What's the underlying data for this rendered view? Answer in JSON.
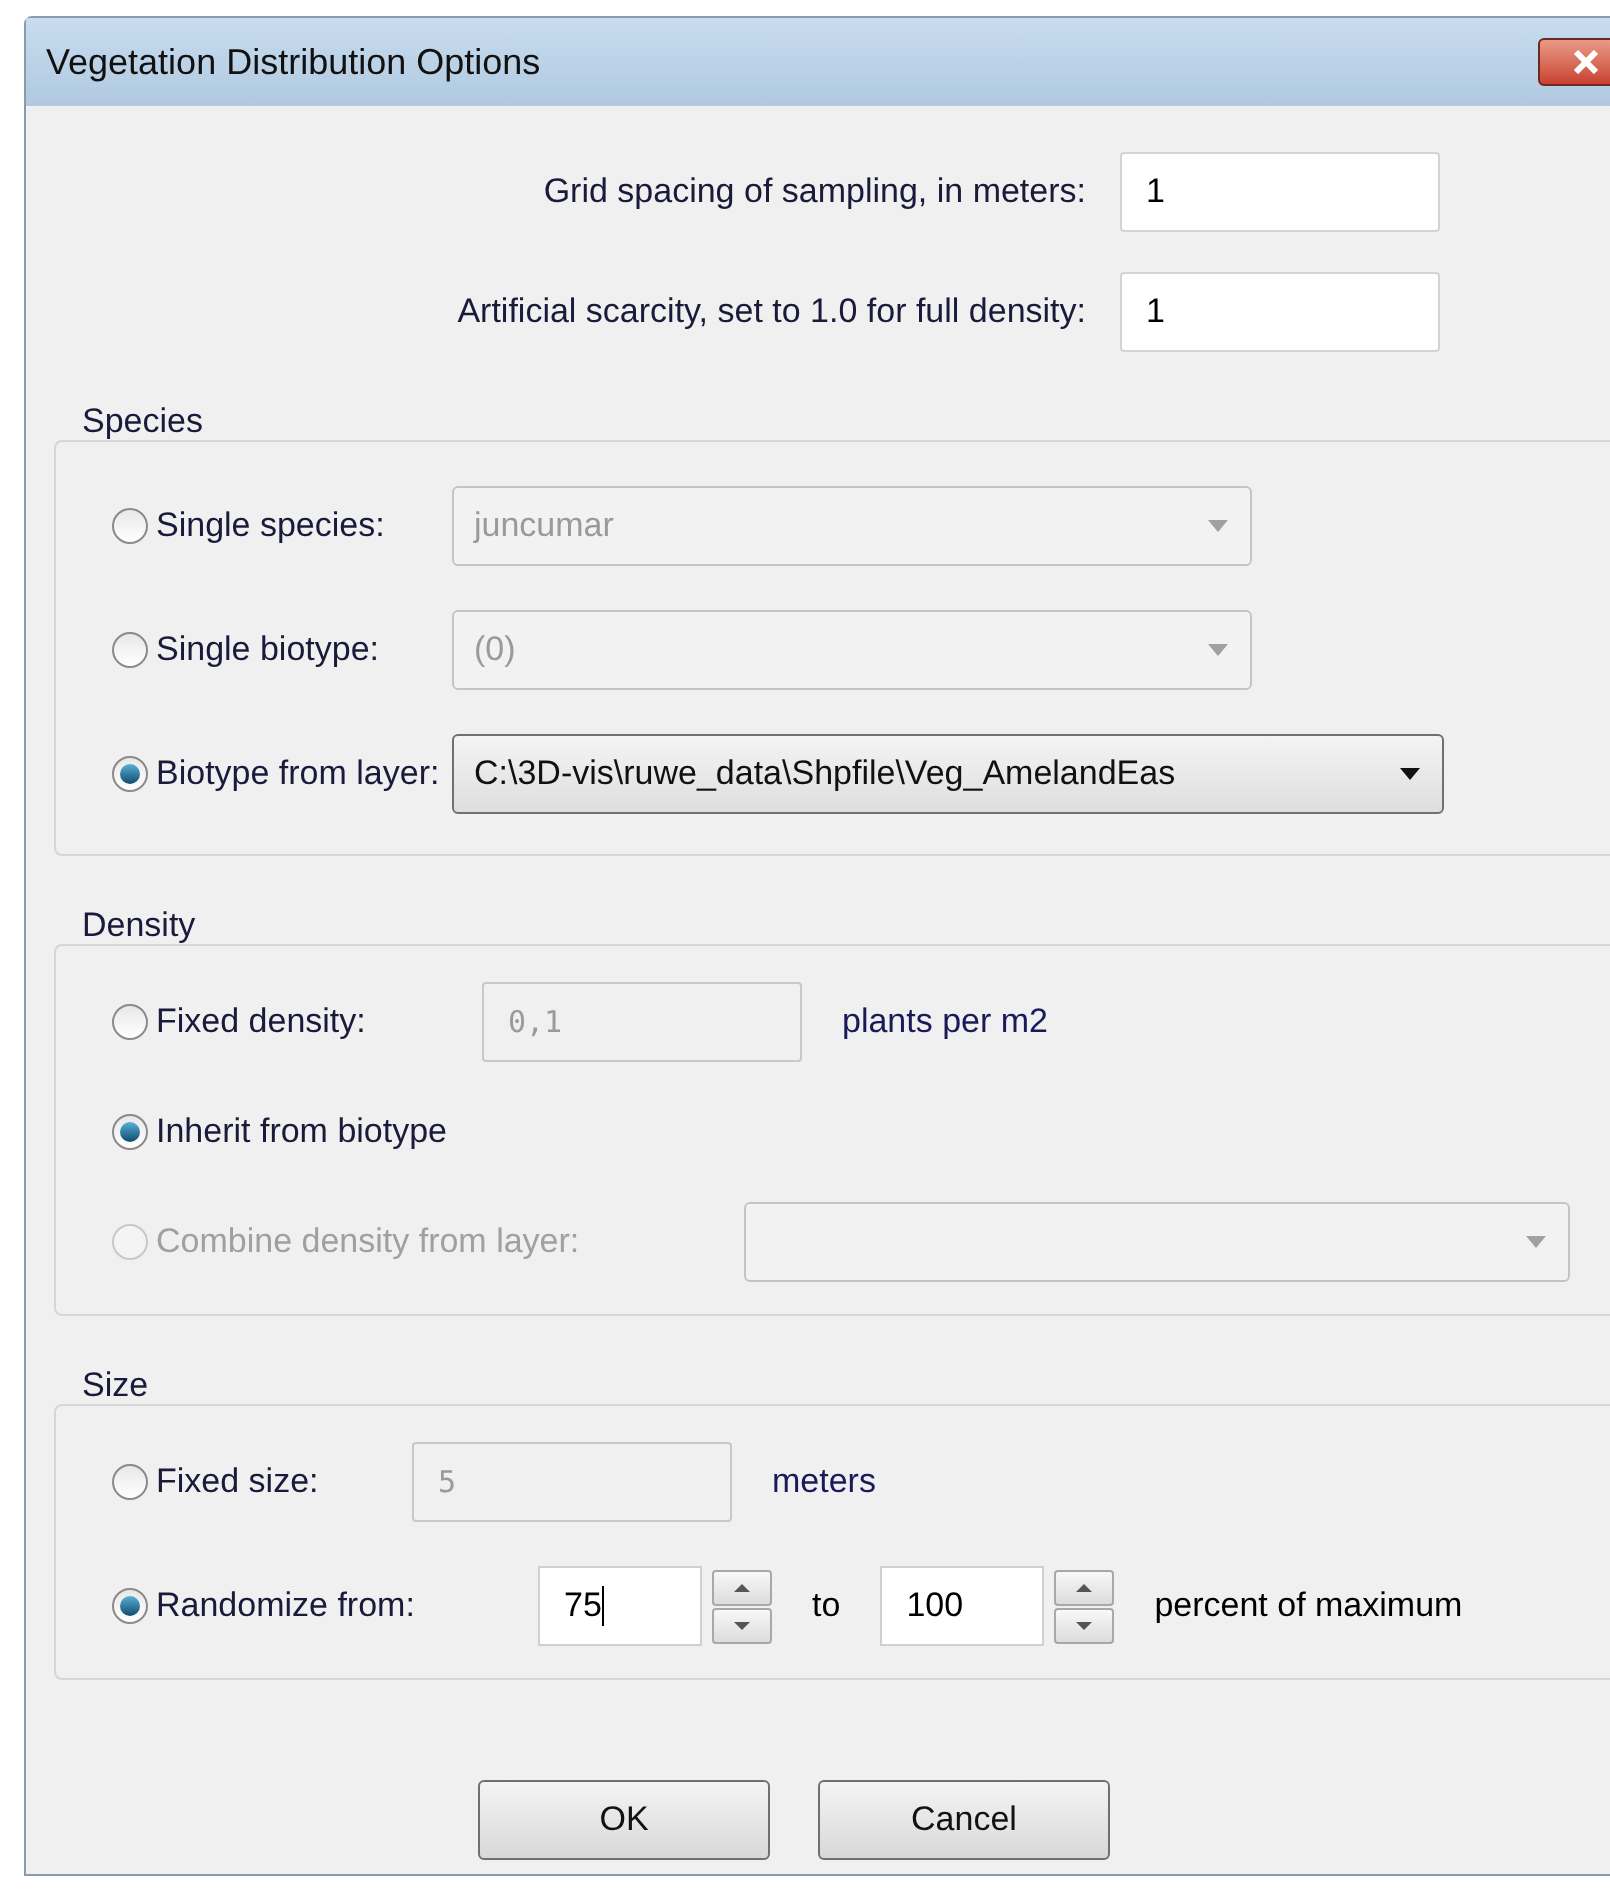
{
  "window": {
    "title": "Vegetation Distribution Options"
  },
  "fields": [
    {
      "label": "Grid spacing of sampling, in meters:",
      "value": "1"
    },
    {
      "label": "Artificial scarcity, set to 1.0 for full density:",
      "value": "1"
    }
  ],
  "groups": [
    {
      "title": "Species",
      "options": [
        {
          "kind": "combo",
          "label": "Single species:",
          "selected": false,
          "disabled": false,
          "value": "juncumar",
          "enabled": false
        },
        {
          "kind": "combo",
          "label": "Single biotype:",
          "selected": false,
          "disabled": false,
          "value": "(0)",
          "enabled": false
        },
        {
          "kind": "combo",
          "label": "Biotype from layer:",
          "selected": true,
          "disabled": false,
          "value": "C:\\3D-vis\\ruwe_data\\Shpfile\\Veg_AmelandEas",
          "enabled": true
        }
      ]
    },
    {
      "title": "Density",
      "options": [
        {
          "kind": "text",
          "label": "Fixed density:",
          "selected": false,
          "disabled": false,
          "value": "0,1",
          "enabled": false,
          "unit": "plants per m2"
        },
        {
          "kind": "plain",
          "label": "Inherit from biotype",
          "selected": true,
          "disabled": false
        },
        {
          "kind": "combo",
          "label": "Combine density from layer:",
          "selected": false,
          "disabled": true,
          "enabled": false
        }
      ]
    },
    {
      "title": "Size",
      "options": [
        {
          "kind": "text",
          "label": "Fixed size:",
          "selected": false,
          "disabled": false,
          "value": "5",
          "enabled": false,
          "unit": "meters"
        },
        {
          "kind": "range",
          "label": "Randomize from:",
          "selected": true,
          "disabled": false,
          "from": "75",
          "joiner": "to",
          "to": "100",
          "unit": "percent of maximum",
          "focused": true
        }
      ]
    }
  ],
  "buttons": [
    "OK",
    "Cancel"
  ]
}
